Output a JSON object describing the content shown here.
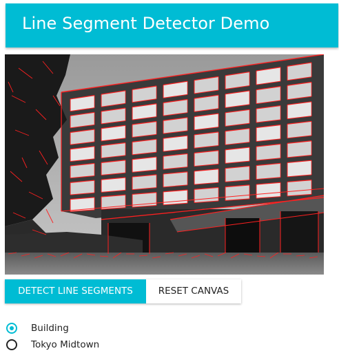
{
  "app": {
    "title": "Line Segment Detector Demo"
  },
  "canvas": {
    "image_subject": "building-photo-with-detected-line-segments"
  },
  "buttons": {
    "detect_label": "DETECT LINE SEGMENTS",
    "reset_label": "RESET CANVAS"
  },
  "image_options": [
    {
      "label": "Building",
      "selected": true
    },
    {
      "label": "Tokyo Midtown",
      "selected": false
    }
  ],
  "colors": {
    "accent": "#00bcd4",
    "segment_color": "#ff2020"
  }
}
